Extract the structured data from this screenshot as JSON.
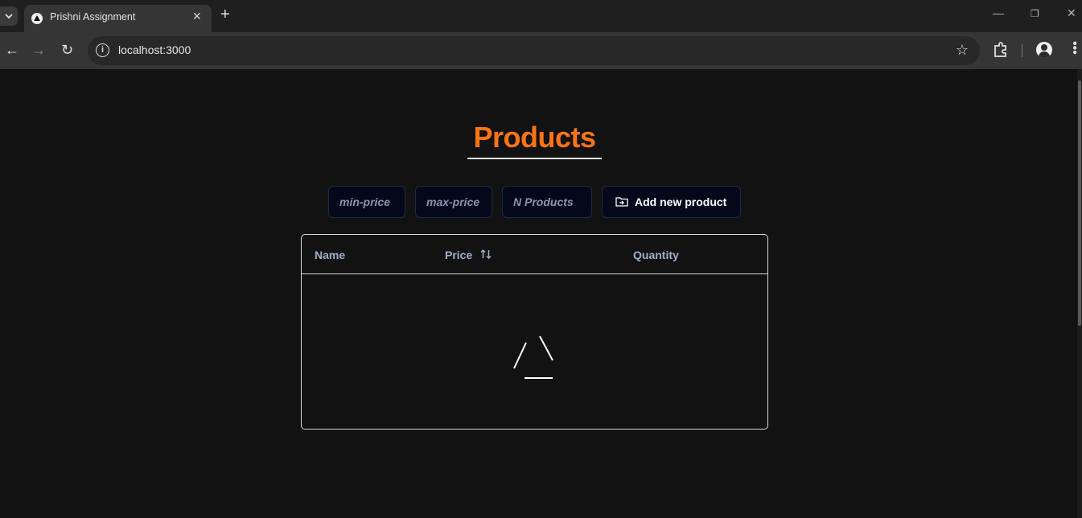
{
  "browser": {
    "tab_title": "Prishni Assignment",
    "url": "localhost:3000"
  },
  "page": {
    "title": "Products",
    "accent_color": "#f97316",
    "filters": {
      "min_price_placeholder": "min-price",
      "max_price_placeholder": "max-price",
      "n_products_placeholder": "N Products"
    },
    "add_button_label": "Add new product",
    "table": {
      "columns": [
        "Name",
        "Price",
        "Quantity"
      ],
      "rows": [],
      "loading": true
    }
  },
  "icons": {
    "tab_list": "chevron-down-icon",
    "favicon": "triangle-icon",
    "close_tab": "close-icon",
    "new_tab": "plus-icon",
    "back": "arrow-left-icon",
    "forward": "arrow-right-icon",
    "reload": "reload-icon",
    "site_info": "info-icon",
    "bookmark": "star-icon",
    "extensions": "puzzle-icon",
    "profile": "avatar-icon",
    "menu": "kebab-icon",
    "add": "folder-plus-icon",
    "sort": "sort-arrows-icon",
    "loader": "spinner-icon"
  }
}
